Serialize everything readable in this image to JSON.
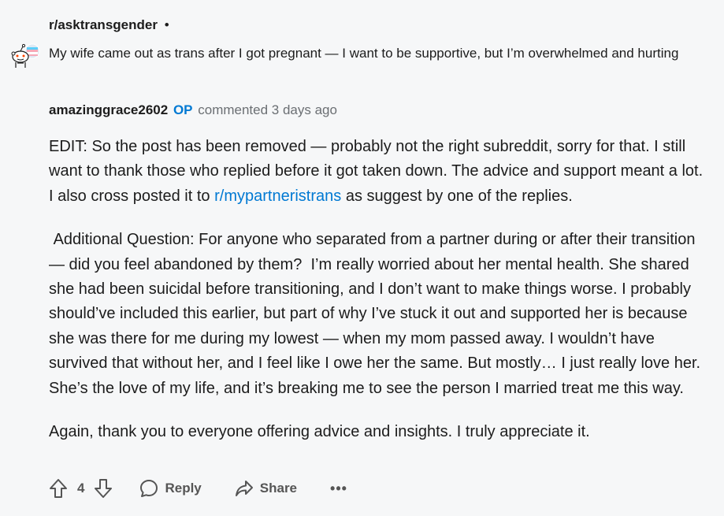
{
  "subreddit": {
    "name": "r/asktransgender",
    "separator": "•"
  },
  "post": {
    "title": "My wife came out as trans after I got pregnant — I want to be supportive, but I’m overwhelmed and hurting"
  },
  "comment": {
    "author": "amazinggrace2602",
    "op_badge": "OP",
    "timestamp": "commented 3 days ago",
    "paragraph1_before_link": "EDIT: So  the post has been removed  — probably not the right subreddit, sorry for that. I still want to thank those who replied before it got taken down. The advice and support meant a lot. I also cross posted it to ",
    "link_text": "r/mypartneristrans",
    "paragraph1_after_link": " as suggest by one of the replies.",
    "paragraph2": " Additional Question: For anyone who separated from a partner during or after their transition — did you feel abandoned by them?  I’m really worried about her mental health. She shared she had been suicidal before transitioning, and I don’t want to make things worse. I probably should’ve included this earlier, but part of why I’ve stuck it out and supported her is because she was there for me during my lowest — when my mom passed away. I wouldn’t have survived that without her, and I feel like I owe her the same. But mostly… I just really love her. She’s the love of my life, and it’s breaking me to see the person I married treat me this way.",
    "paragraph3": "Again, thank you to everyone offering advice and insights. I truly appreciate it."
  },
  "actions": {
    "vote_count": "4",
    "reply_label": "Reply",
    "share_label": "Share",
    "more_label": "•••"
  },
  "icons": {
    "avatar": "snoo-avatar-icon",
    "upvote": "arrow-up-icon",
    "downvote": "arrow-down-icon",
    "reply": "chat-bubble-icon",
    "share": "share-arrow-icon",
    "more": "ellipsis-icon"
  },
  "colors": {
    "background": "#f6f7f8",
    "accent": "#0079d3",
    "text": "#1c1c1c",
    "muted": "#6b6f73"
  }
}
